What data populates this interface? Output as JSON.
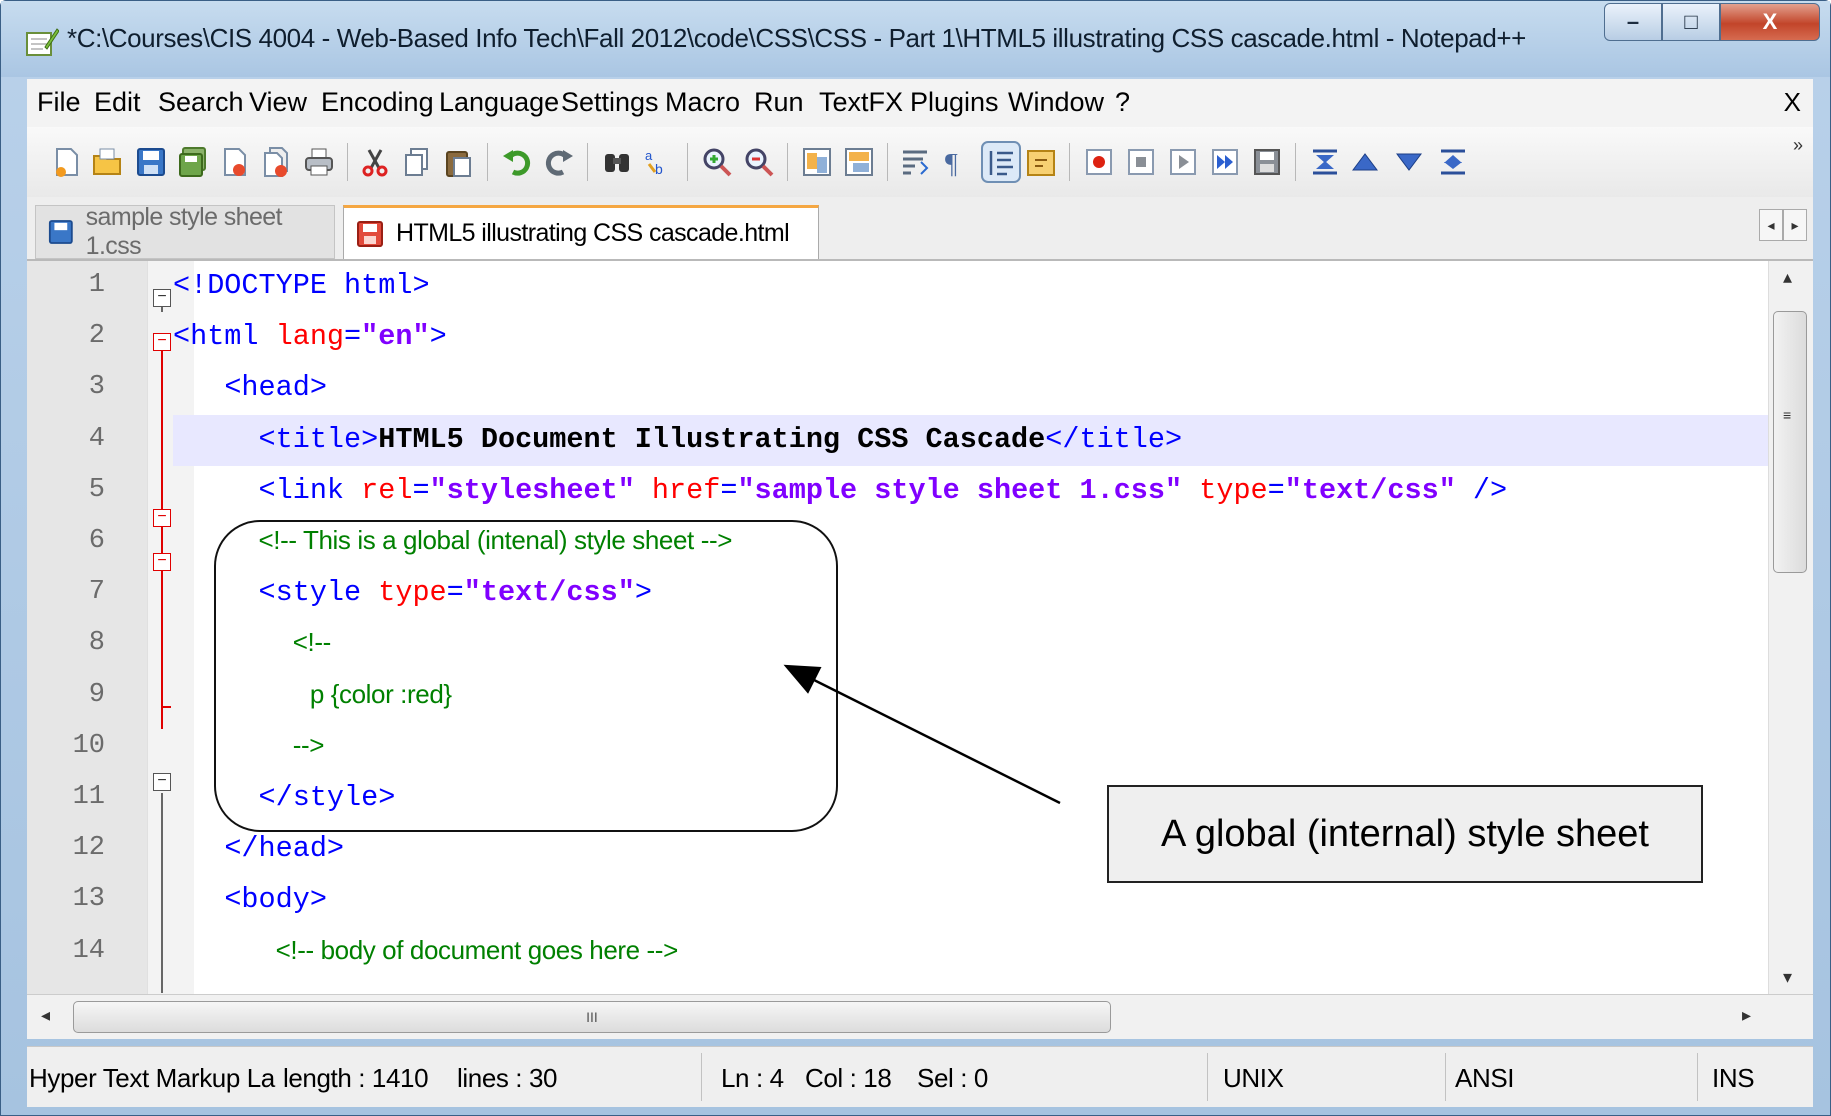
{
  "window": {
    "title": "*C:\\Courses\\CIS 4004 - Web-Based Info Tech\\Fall 2012\\code\\CSS\\CSS - Part 1\\HTML5 illustrating CSS cascade.html - Notepad++",
    "minimize_label": "–",
    "maximize_label": "□",
    "close_label": "X"
  },
  "menu": {
    "items": [
      "File",
      "Edit",
      "Search",
      "View",
      "Encoding",
      "Language",
      "Settings",
      "Macro",
      "Run",
      "TextFX",
      "Plugins",
      "Window",
      "?"
    ],
    "close_label": "X"
  },
  "toolbar": {
    "icons": [
      "new-file-icon",
      "open-file-icon",
      "save-icon",
      "save-all-icon",
      "close-icon",
      "close-all-icon",
      "print-icon",
      "cut-icon",
      "copy-icon",
      "paste-icon",
      "undo-icon",
      "redo-icon",
      "find-icon",
      "replace-icon",
      "zoom-in-icon",
      "zoom-out-icon",
      "sync-vertical-icon",
      "sync-horizontal-icon",
      "word-wrap-icon",
      "show-all-chars-icon",
      "indent-guide-icon",
      "lang-folder-icon",
      "record-macro-icon",
      "stop-record-icon",
      "play-macro-icon",
      "run-multiple-icon",
      "save-macro-icon",
      "collapse-all-icon",
      "prev-icon",
      "next-icon",
      "expand-all-icon"
    ],
    "overflow_label": "»"
  },
  "tabs": [
    {
      "label": "sample style sheet 1.css",
      "active": false
    },
    {
      "label": "HTML5 illustrating CSS cascade.html",
      "active": true
    }
  ],
  "editor": {
    "line_numbers": [
      "1",
      "2",
      "3",
      "4",
      "5",
      "6",
      "7",
      "8",
      "9",
      "10",
      "11",
      "12",
      "13",
      "14"
    ],
    "lines": [
      {
        "html": "<span class='tag'>&lt;!DOCTYPE html&gt;</span>"
      },
      {
        "html": "<span class='tag'>&lt;html </span><span class='attr'>lang</span><span class='tag'>=</span><span class='val'>\"en\"</span><span class='tag'>&gt;</span>"
      },
      {
        "html": "   <span class='tag'>&lt;head&gt;</span>"
      },
      {
        "html": "     <span class='tag'>&lt;title&gt;</span><span class='txt'>HTML5 Document Illustrating CSS Cascade</span><span class='tag'>&lt;/title&gt;</span>"
      },
      {
        "html": "     <span class='tag'>&lt;link </span><span class='attr'>rel</span><span class='tag'>=</span><span class='val'>\"stylesheet\"</span> <span class='attr'>href</span><span class='tag'>=</span><span class='val'>\"sample style sheet 1.css\"</span> <span class='attr'>type</span><span class='tag'>=</span><span class='val'>\"text/css\"</span> <span class='tag'>/&gt;</span>"
      },
      {
        "html": "     <span class='cmt'>&lt;!-- This is a global (intenal) style sheet --&gt;</span>"
      },
      {
        "html": "     <span class='tag'>&lt;style </span><span class='attr'>type</span><span class='tag'>=</span><span class='val'>\"text/css\"</span><span class='tag'>&gt;</span>"
      },
      {
        "html": "       <span class='cmt'>&lt;!--</span>"
      },
      {
        "html": "        <span class='cmt'>p {color :red}</span>"
      },
      {
        "html": "       <span class='cmt'>--&gt;</span>"
      },
      {
        "html": "     <span class='tag'>&lt;/style&gt;</span>"
      },
      {
        "html": "   <span class='tag'>&lt;/head&gt;</span>"
      },
      {
        "html": "   <span class='tag'>&lt;body&gt;</span>"
      },
      {
        "html": "      <span class='cmt'>&lt;!-- body of document goes here --&gt;</span>"
      }
    ],
    "hscroll_grip": "III"
  },
  "status": {
    "lang": "Hyper Text Markup La",
    "length": "length : 1410",
    "lines": "lines : 30",
    "ln": "Ln : 4",
    "col": "Col : 18",
    "sel": "Sel : 0",
    "eol": "UNIX",
    "encoding": "ANSI",
    "mode": "INS"
  },
  "annotation": {
    "callout": "A global (internal) style sheet"
  }
}
